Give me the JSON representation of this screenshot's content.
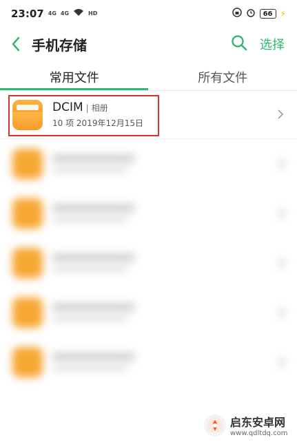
{
  "status_bar": {
    "time": "23:07",
    "signal_1": "4G",
    "signal_2": "4G",
    "hd_label": "HD",
    "battery": "66"
  },
  "app_bar": {
    "title": "手机存储",
    "select_label": "选择",
    "accent_color": "#2fb874"
  },
  "tabs": [
    {
      "label": "常用文件",
      "active": true
    },
    {
      "label": "所有文件",
      "active": false
    }
  ],
  "folders": [
    {
      "name": "DCIM",
      "tag": "相册",
      "count": "10 项",
      "date": "2019年12月15日"
    }
  ],
  "watermark": {
    "name": "启东安卓网",
    "url": "www.qdltdq.com"
  }
}
